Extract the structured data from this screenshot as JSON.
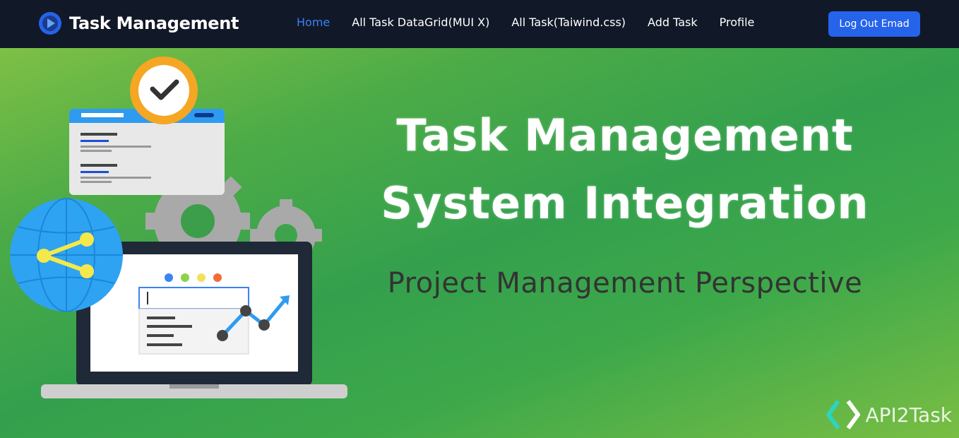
{
  "navbar": {
    "brand_title": "Task Management",
    "brand_icon": "play-circle-icon",
    "links": [
      {
        "label": "Home",
        "active": true
      },
      {
        "label": "All Task DataGrid(MUI X)",
        "active": false
      },
      {
        "label": "All Task(Taiwind.css)",
        "active": false
      },
      {
        "label": "Add Task",
        "active": false
      },
      {
        "label": "Profile",
        "active": false
      }
    ],
    "logout_label": "Log Out Emad"
  },
  "hero": {
    "title_line1": "Task Management",
    "title_line2": "System Integration",
    "subtitle": "Project Management Perspective",
    "watermark": "API2Task"
  },
  "colors": {
    "navbar_bg": "#111827",
    "accent": "#3b82f6",
    "button_bg": "#2563eb",
    "hero_green": "#34a04d",
    "hero_light_green": "#7ec046"
  }
}
